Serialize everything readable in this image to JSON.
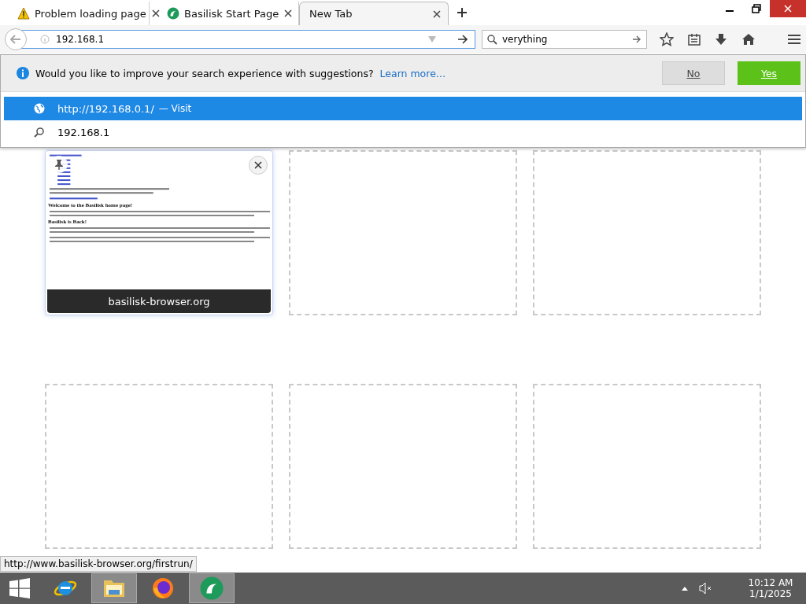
{
  "tabs": [
    {
      "title": "Problem loading page",
      "kind": "warning",
      "selected": false
    },
    {
      "title": "Basilisk Start Page",
      "kind": "basilisk",
      "selected": false
    },
    {
      "title": "New Tab",
      "kind": "none",
      "selected": true
    }
  ],
  "address_bar": {
    "value": "192.168.1"
  },
  "search_bar": {
    "value": "verything"
  },
  "suggestion_prompt": {
    "text": "Would you like to improve your search experience with suggestions?",
    "link": "Learn more…",
    "buttons": [
      {
        "label": "No",
        "kind": "secondary"
      },
      {
        "label": "Yes",
        "kind": "primary"
      }
    ]
  },
  "autocomplete": [
    {
      "kind": "visit",
      "text": "http://192.168.0.1/",
      "separator": "—",
      "action": "Visit",
      "selected": true
    },
    {
      "kind": "search",
      "text": "192.168.1",
      "selected": false
    }
  ],
  "tiles": [
    {
      "kind": "site",
      "title": "basilisk-browser.org",
      "headings": [
        "Welcome to the Basilisk home page!",
        "Basilisk is Back!"
      ]
    },
    {
      "kind": "empty"
    },
    {
      "kind": "empty"
    },
    {
      "kind": "empty"
    },
    {
      "kind": "empty"
    },
    {
      "kind": "empty"
    }
  ],
  "status_url": "http://www.basilisk-browser.org/firstrun/",
  "taskbar": {
    "apps": [
      {
        "kind": "ie",
        "selected": false
      },
      {
        "kind": "explorer",
        "selected": true
      },
      {
        "kind": "firefox",
        "selected": false
      },
      {
        "kind": "basilisk",
        "selected": true
      }
    ],
    "time": "10:12 AM",
    "date": "1/1/2025"
  }
}
